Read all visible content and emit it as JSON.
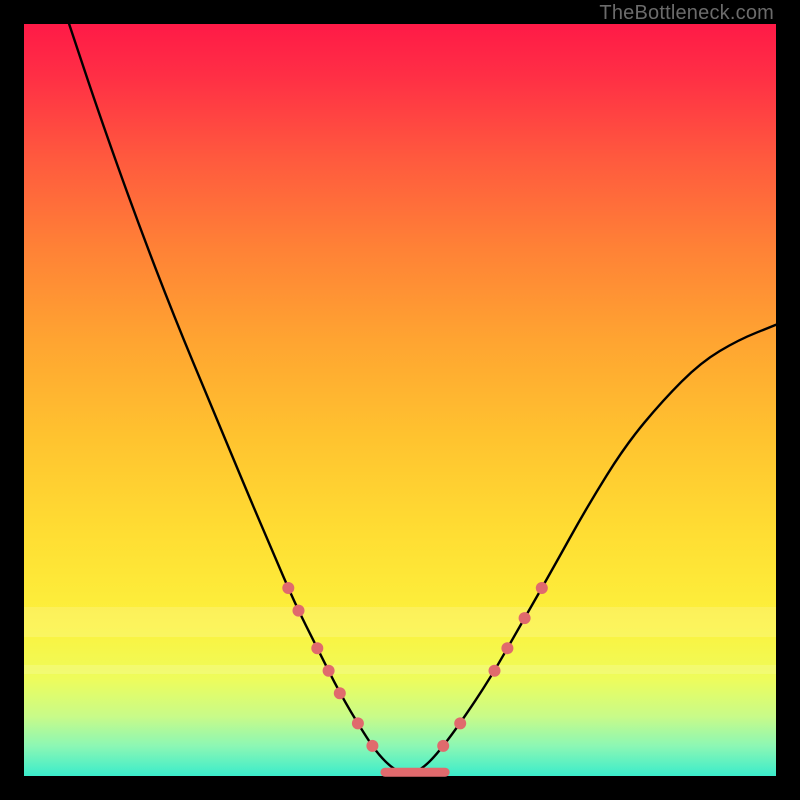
{
  "watermark": "TheBottleneck.com",
  "chart_data": {
    "type": "line",
    "title": "",
    "subtitle": "",
    "xlabel": "",
    "ylabel": "",
    "xlim": [
      0,
      100
    ],
    "ylim": [
      0,
      100
    ],
    "grid": false,
    "legend_position": "none",
    "series": [
      {
        "name": "bottleneck-curve",
        "color": "#000000",
        "x": [
          6,
          10,
          15,
          20,
          25,
          30,
          33,
          36,
          39,
          42,
          45,
          47,
          49,
          51,
          53,
          55,
          58,
          62,
          66,
          70,
          75,
          80,
          85,
          90,
          95,
          100
        ],
        "y": [
          100,
          88,
          74,
          61,
          49,
          37,
          30,
          23,
          17,
          11,
          6,
          3,
          1,
          0,
          1,
          3,
          7,
          13,
          20,
          27,
          36,
          44,
          50,
          55,
          58,
          60
        ]
      }
    ],
    "highlight_stripes_y": [
      {
        "from": 18.5,
        "to": 22.5,
        "alpha": 0.4
      },
      {
        "from": 13.5,
        "to": 14.8,
        "alpha": 0.4
      }
    ],
    "markers": [
      {
        "series": "bottleneck-curve",
        "y": 25,
        "side": "left",
        "kind": "nub"
      },
      {
        "series": "bottleneck-curve",
        "y": 22,
        "side": "left",
        "kind": "nub"
      },
      {
        "series": "bottleneck-curve",
        "y": 17,
        "side": "left",
        "kind": "nub"
      },
      {
        "series": "bottleneck-curve",
        "y": 14,
        "side": "left",
        "kind": "nub"
      },
      {
        "series": "bottleneck-curve",
        "y": 11,
        "side": "left",
        "kind": "nub"
      },
      {
        "series": "bottleneck-curve",
        "y": 7,
        "side": "left",
        "kind": "nub"
      },
      {
        "series": "bottleneck-curve",
        "y": 4,
        "side": "left",
        "kind": "nub"
      },
      {
        "series": "bottleneck-curve",
        "y": 25,
        "side": "right",
        "kind": "nub"
      },
      {
        "series": "bottleneck-curve",
        "y": 21,
        "side": "right",
        "kind": "nub"
      },
      {
        "series": "bottleneck-curve",
        "y": 17,
        "side": "right",
        "kind": "nub"
      },
      {
        "series": "bottleneck-curve",
        "y": 14,
        "side": "right",
        "kind": "nub"
      },
      {
        "series": "bottleneck-curve",
        "y": 7,
        "side": "right",
        "kind": "nub"
      },
      {
        "series": "bottleneck-curve",
        "y": 4,
        "side": "right",
        "kind": "nub"
      }
    ],
    "bottom_segment": {
      "y": 0.5,
      "x_from": 48,
      "x_to": 56
    }
  },
  "colors": {
    "marker": "#e06a6d",
    "curve": "#000000"
  }
}
